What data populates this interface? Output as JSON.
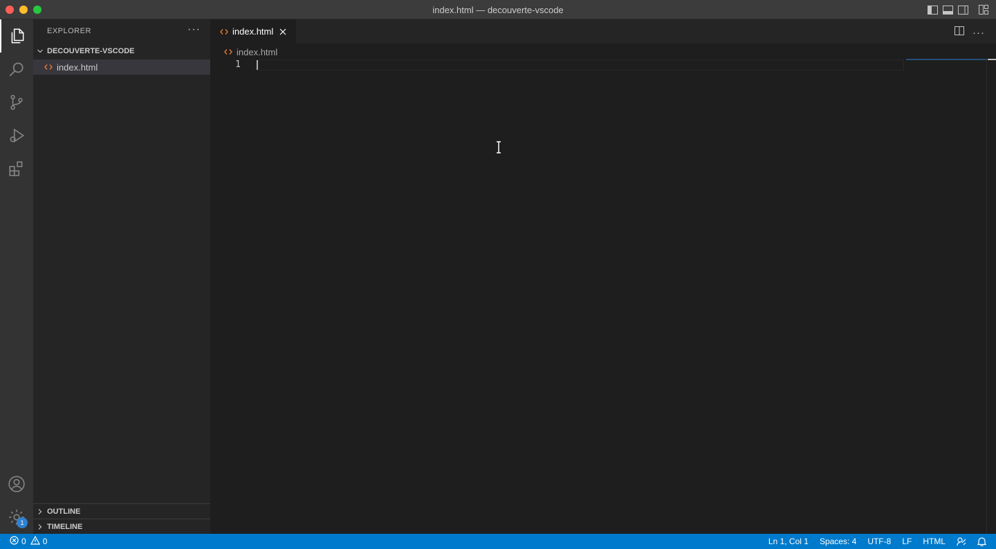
{
  "window": {
    "title": "index.html — decouverte-vscode"
  },
  "explorer": {
    "header": "EXPLORER",
    "more": "···",
    "folder": "DECOUVERTE-VSCODE",
    "files": [
      {
        "name": "index.html"
      }
    ],
    "panels": {
      "outline": "OUTLINE",
      "timeline": "TIMELINE"
    }
  },
  "activity": {
    "settings_badge": "1"
  },
  "editor": {
    "tab": {
      "label": "index.html"
    },
    "breadcrumb": "index.html",
    "line_numbers": [
      "1"
    ],
    "more": "···"
  },
  "statusbar": {
    "errors": "0",
    "warnings": "0",
    "position": "Ln 1, Col 1",
    "spaces": "Spaces: 4",
    "encoding": "UTF-8",
    "eol": "LF",
    "language": "HTML"
  },
  "colors": {
    "accent": "#007acc",
    "html_icon": "#e37933"
  }
}
